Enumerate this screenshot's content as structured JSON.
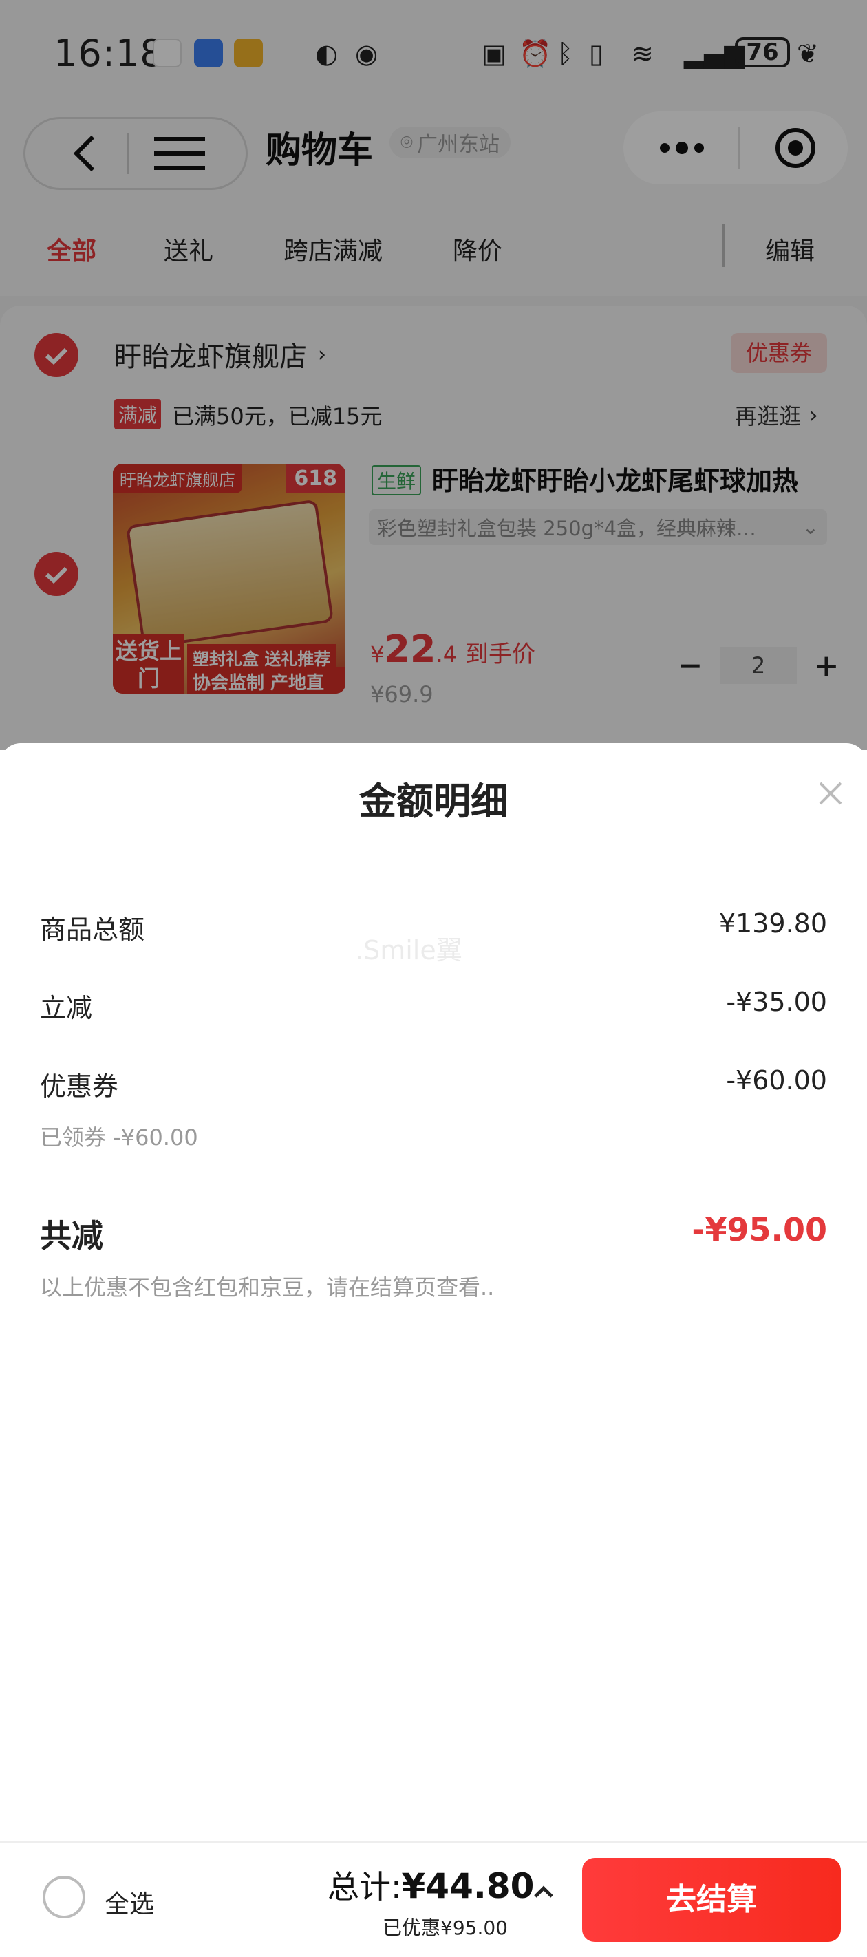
{
  "status_bar": {
    "time": "16:18",
    "battery": "76",
    "icons": [
      "china-mobile-app-icon",
      "transfer-app-icon",
      "mail-app-icon",
      "hd-icon",
      "eye-icon",
      "nfc-icon",
      "alarm-icon",
      "bluetooth-icon",
      "vibrate-icon",
      "wifi-icon",
      "signal-icon",
      "leaf-icon"
    ]
  },
  "header": {
    "title": "购物车",
    "location": "广州东站"
  },
  "tabs": [
    "全部",
    "送礼",
    "跨店满减",
    "降价"
  ],
  "edit_label": "编辑",
  "shop": {
    "name": "盱眙龙虾旗舰店",
    "coupon_tag": "优惠券",
    "promo_tag": "满减",
    "promo_text": "已满50元，已减15元",
    "more_link": "再逛逛"
  },
  "product": {
    "image_labels": {
      "shop": "盱眙龙虾旗舰店",
      "badge": "618",
      "delivery": "送货上门",
      "tag_a": "塑封礼盒 送礼推荐",
      "tag_b": "协会监制 产地直发"
    },
    "fresh_tag": "生鲜",
    "title": "盱眙龙虾盱眙小龙虾尾虾球加热",
    "sku": "彩色塑封礼盒包装 250g*4盒，经典麻辣…",
    "price_yen": "¥",
    "price_int": "22",
    "price_dec": ".4",
    "price_label": "到手价",
    "original_price": "¥69.9",
    "quantity": "2",
    "qty_minus": "−",
    "qty_plus": "+"
  },
  "sheet": {
    "title": "金额明细",
    "watermark": ".Smile翼",
    "rows": [
      {
        "label": "商品总额",
        "value": "¥139.80"
      },
      {
        "label": "立减",
        "value": "-¥35.00"
      },
      {
        "label": "优惠券",
        "value": "-¥60.00",
        "note": "已领券 -¥60.00"
      }
    ],
    "total_label": "共减",
    "total_value": "-¥95.00",
    "footnote": "以上优惠不包含红包和京豆，请在结算页查看.."
  },
  "bottom_bar": {
    "select_all": "全选",
    "sum_prefix": "总计:",
    "sum_value": "¥44.80",
    "saved": "已优惠¥95.00",
    "checkout": "去结算"
  },
  "colors": {
    "accent": "#e4393c",
    "fresh": "#3aa35a"
  }
}
